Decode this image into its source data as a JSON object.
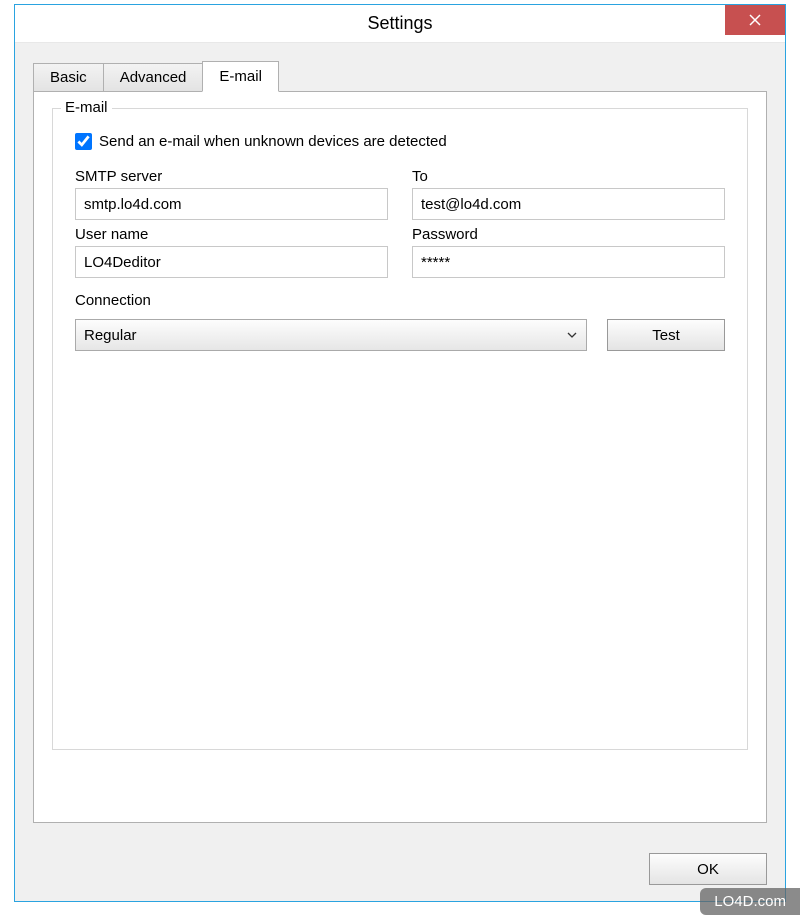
{
  "window": {
    "title": "Settings"
  },
  "tabs": [
    {
      "label": "Basic",
      "active": false
    },
    {
      "label": "Advanced",
      "active": false
    },
    {
      "label": "E-mail",
      "active": true
    }
  ],
  "group": {
    "legend": "E-mail",
    "checkbox": {
      "label": "Send an e-mail when unknown devices are detected",
      "checked": true
    },
    "fields": {
      "smtp": {
        "label": "SMTP server",
        "value": "smtp.lo4d.com"
      },
      "to": {
        "label": "To",
        "value": "test@lo4d.com"
      },
      "username": {
        "label": "User name",
        "value": "LO4Deditor"
      },
      "password": {
        "label": "Password",
        "value": "*****"
      }
    },
    "connection": {
      "label": "Connection",
      "selected": "Regular"
    },
    "test_button": "Test"
  },
  "footer": {
    "ok": "OK"
  },
  "watermark": "LO4D.com"
}
